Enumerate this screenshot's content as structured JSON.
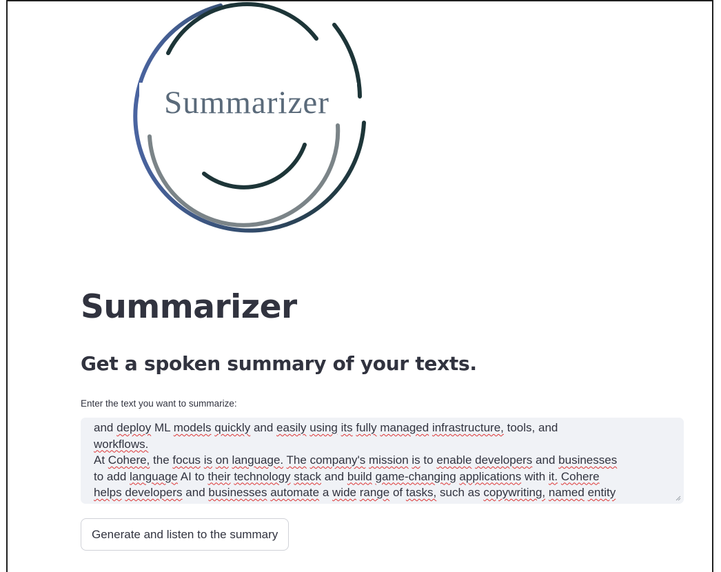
{
  "logo": {
    "wordmark": "Summarizer",
    "colors": {
      "dark": "#1d3538",
      "blue": "#4a64a0",
      "gray": "#7b8488"
    }
  },
  "page": {
    "title": "Summarizer",
    "subtitle": "Get a spoken summary of your texts."
  },
  "input": {
    "label": "Enter the text you want to summarize:",
    "value_lines": [
      "and deploy ML models quickly and easily using its fully managed infrastructure, tools, and",
      "workflows.",
      "At Cohere, the focus is on language. The company's mission is to enable developers and businesses",
      "to add language AI to their technology stack and build game-changing applications with it. Cohere",
      "helps developers and businesses automate a wide range of tasks, such as copywriting, named entity"
    ]
  },
  "actions": {
    "generate_label": "Generate and listen to the summary"
  },
  "theme": {
    "text": "#31333f",
    "input_bg": "#f0f2f6",
    "spellcheck": "#dd3333"
  }
}
